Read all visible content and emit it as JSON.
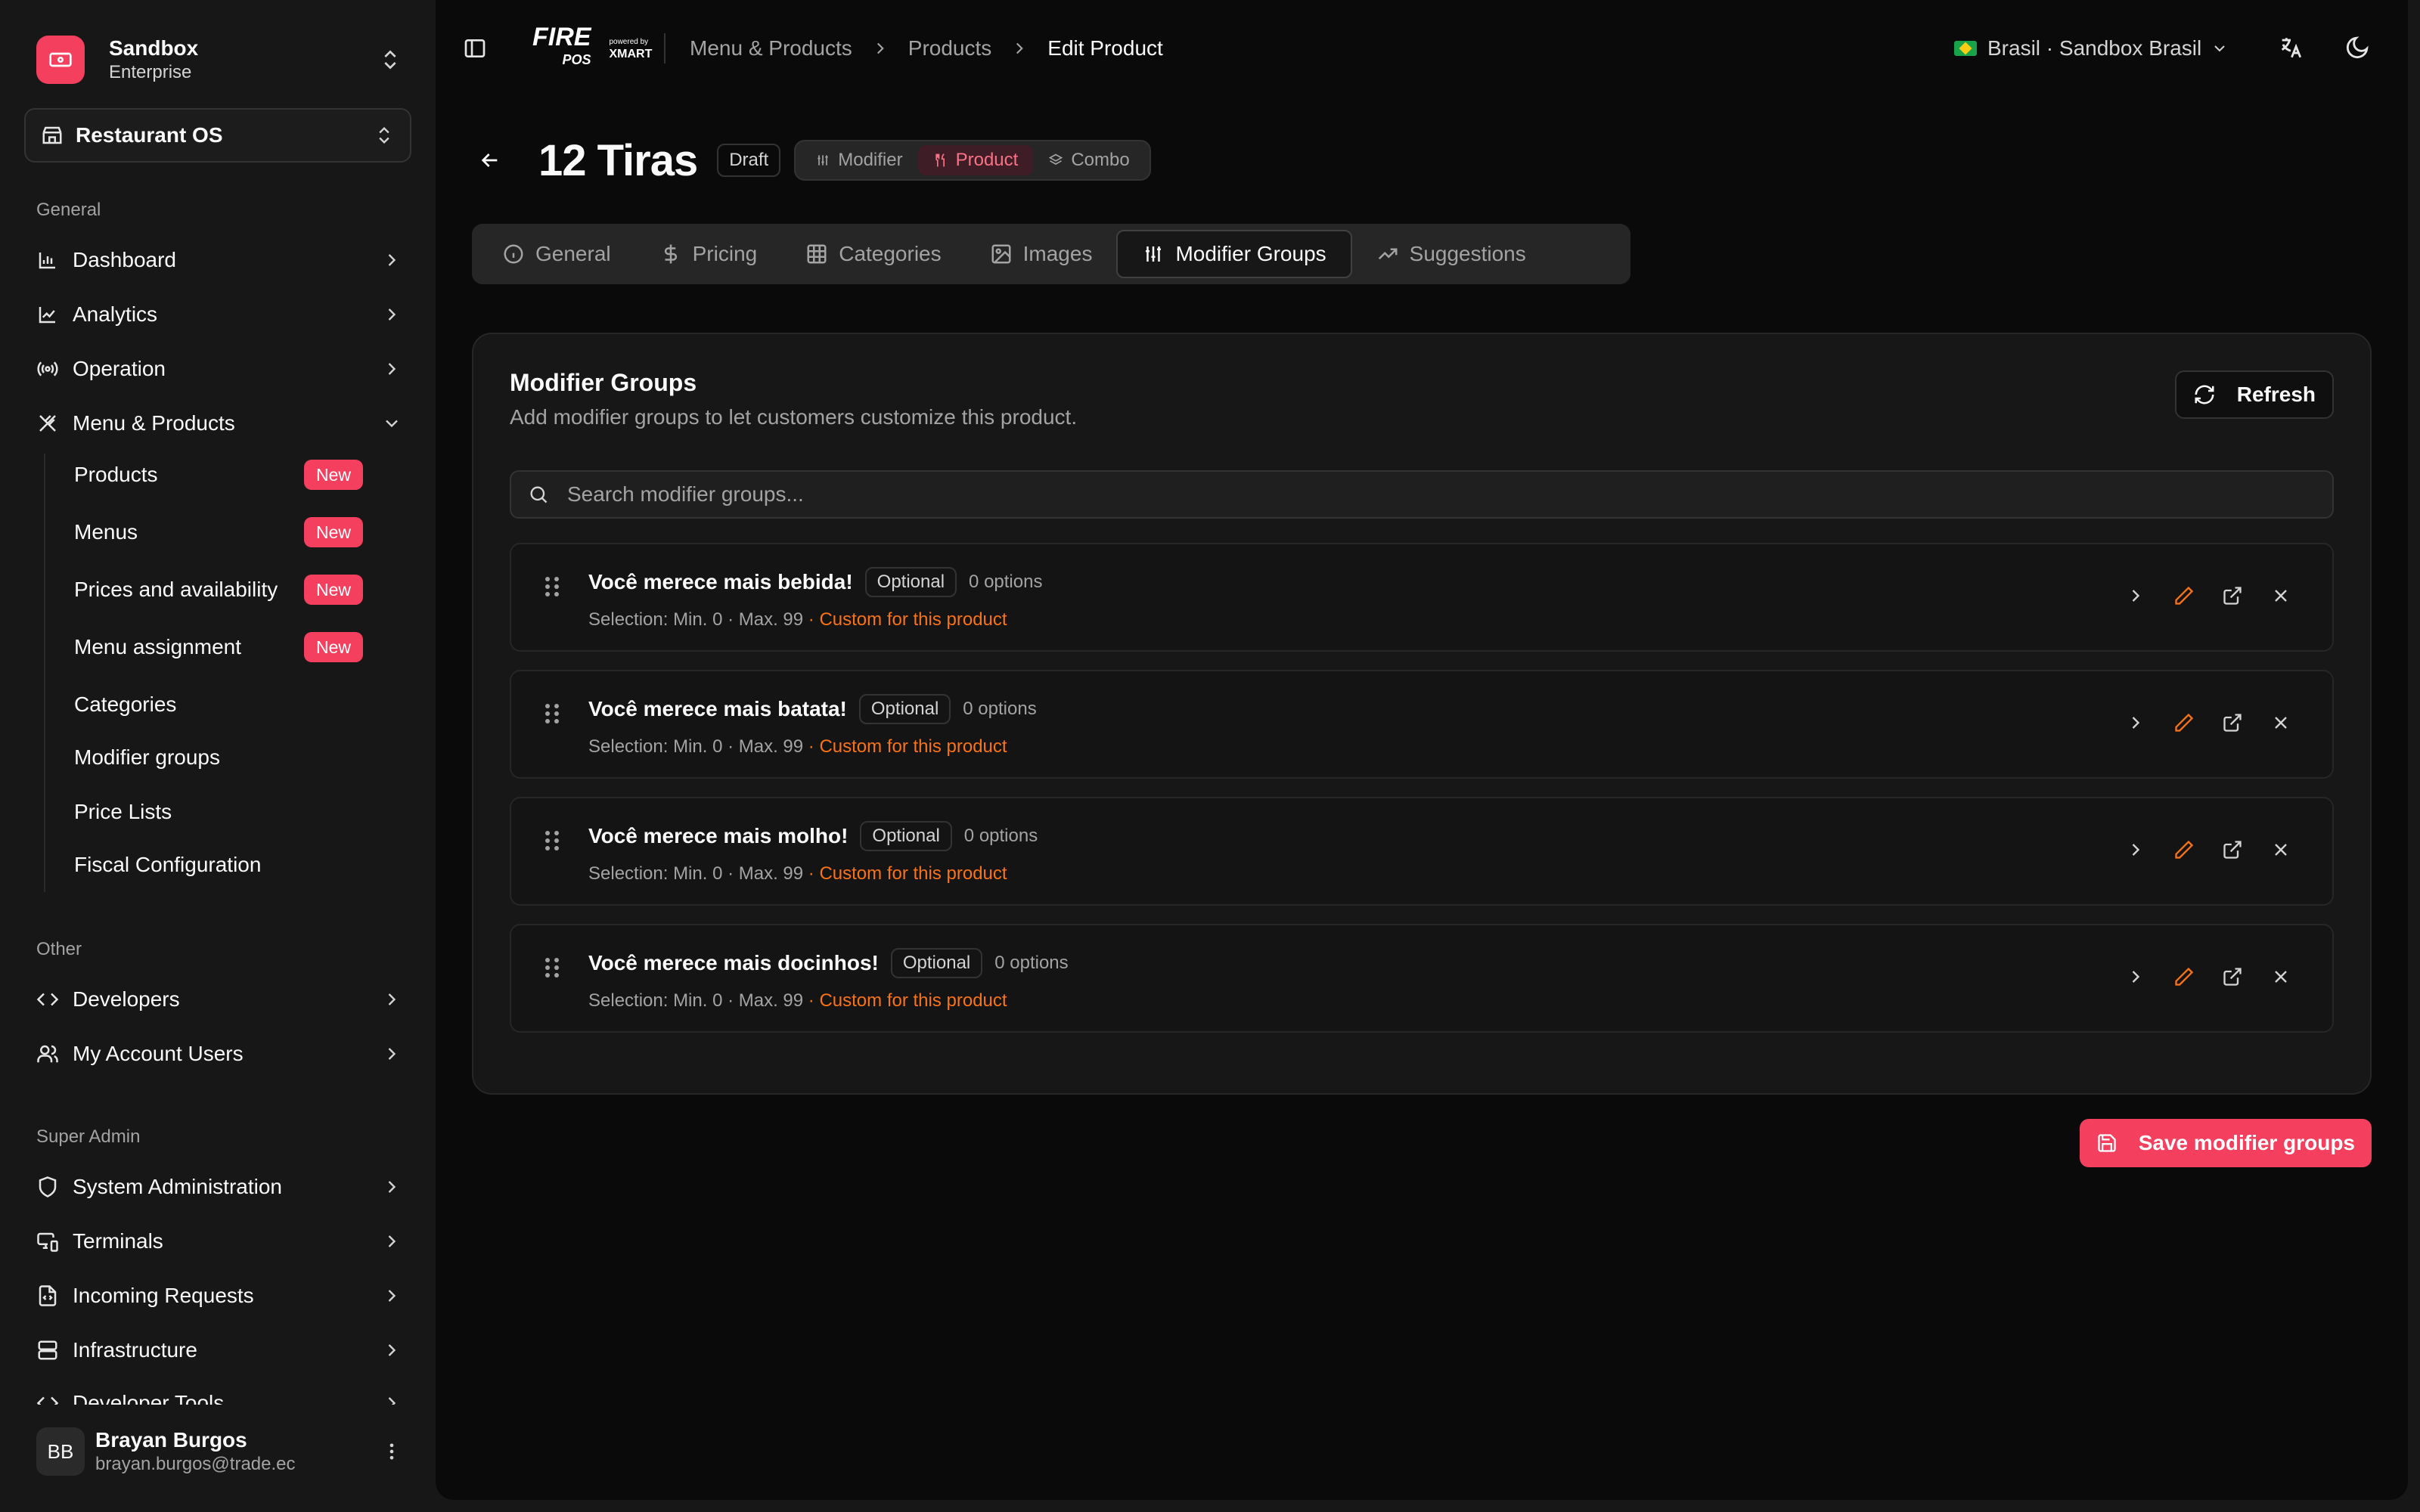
{
  "sidebar": {
    "org": {
      "name": "Sandbox",
      "plan": "Enterprise"
    },
    "app_selector": "Restaurant OS",
    "sections": {
      "general": "General",
      "other": "Other",
      "super_admin": "Super Admin"
    },
    "general_items": [
      "Dashboard",
      "Analytics",
      "Operation",
      "Menu & Products"
    ],
    "menu_products_children": [
      {
        "label": "Products",
        "badge": "New"
      },
      {
        "label": "Menus",
        "badge": "New"
      },
      {
        "label": "Prices and availability",
        "badge": "New"
      },
      {
        "label": "Menu assignment",
        "badge": "New"
      },
      {
        "label": "Categories"
      },
      {
        "label": "Modifier groups"
      },
      {
        "label": "Price Lists"
      },
      {
        "label": "Fiscal Configuration"
      }
    ],
    "other_items": [
      "Developers",
      "My Account Users"
    ],
    "admin_items": [
      "System Administration",
      "Terminals",
      "Incoming Requests",
      "Infrastructure",
      "Developer Tools"
    ],
    "user": {
      "initials": "BB",
      "name": "Brayan Burgos",
      "email": "brayan.burgos@trade.ec"
    }
  },
  "topbar": {
    "brand": {
      "fire": "FIRE",
      "pos": "POS",
      "powered": "powered by",
      "xmart": "XMART"
    },
    "breadcrumb": [
      "Menu & Products",
      "Products",
      "Edit Product"
    ],
    "country": "Brasil · Sandbox Brasil"
  },
  "product": {
    "title": "12 Tiras",
    "status": "Draft",
    "types": [
      "Modifier",
      "Product",
      "Combo"
    ],
    "active_type": "Product"
  },
  "tabs": [
    "General",
    "Pricing",
    "Categories",
    "Images",
    "Modifier Groups",
    "Suggestions"
  ],
  "active_tab": "Modifier Groups",
  "card": {
    "title": "Modifier Groups",
    "description": "Add modifier groups to let customers customize this product.",
    "refresh_label": "Refresh",
    "search_placeholder": "Search modifier groups..."
  },
  "groups": [
    {
      "name": "Você merece mais bebida!",
      "tag": "Optional",
      "options": "0 options",
      "selection": "Selection: Min. 0 · Max. 99",
      "custom": "· Custom for this product"
    },
    {
      "name": "Você merece mais batata!",
      "tag": "Optional",
      "options": "0 options",
      "selection": "Selection: Min. 0 · Max. 99",
      "custom": "· Custom for this product"
    },
    {
      "name": "Você merece mais molho!",
      "tag": "Optional",
      "options": "0 options",
      "selection": "Selection: Min. 0 · Max. 99",
      "custom": "· Custom for this product"
    },
    {
      "name": "Você merece mais docinhos!",
      "tag": "Optional",
      "options": "0 options",
      "selection": "Selection: Min. 0 · Max. 99",
      "custom": "· Custom for this product"
    }
  ],
  "save_label": "Save modifier groups",
  "colors": {
    "accent": "#f43f5e",
    "custom": "#f97316",
    "background": "#0a0a0a"
  }
}
